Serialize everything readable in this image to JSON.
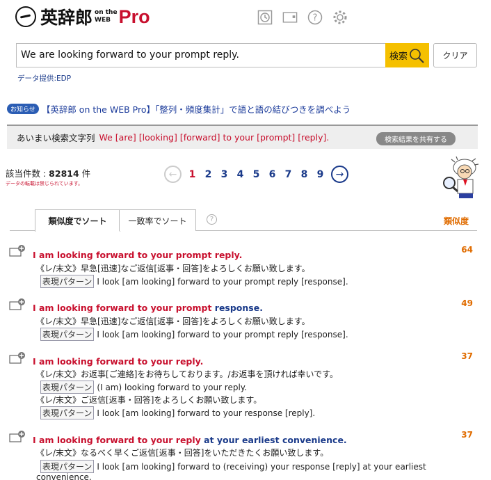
{
  "header": {
    "logo_jp": "英辞郎",
    "logo_on": "on the",
    "logo_web": "WEB",
    "logo_pro": "Pro"
  },
  "search": {
    "value": "We are looking forward to your prompt reply.",
    "button": "検索",
    "clear": "クリア"
  },
  "provider": "データ提供:EDP",
  "notice": {
    "badge": "お知らせ",
    "text": "【英辞郎 on the WEB Pro】「整列・頻度集計」で語と語の結びつきを調べよう"
  },
  "fuzzy": {
    "label": "あいまい検索文字列",
    "query": "We [are] [looking] [forward] to your [prompt] [reply].",
    "share": "検索結果を共有する"
  },
  "count": {
    "label": "該当件数 : ",
    "value": "82814",
    "unit": " 件",
    "note": "データの転載は禁じられています。"
  },
  "pager": {
    "pages": [
      "1",
      "2",
      "3",
      "4",
      "5",
      "6",
      "7",
      "8",
      "9"
    ],
    "current": "1"
  },
  "tabs": {
    "similarity": "類似度でソート",
    "match": "一致率でソート",
    "help": "?",
    "score_label": "類似度"
  },
  "results": [
    {
      "score": "64",
      "head_red": "I am looking forward to your prompt reply.",
      "head_blue": "",
      "lines": [
        {
          "tag": "",
          "text": "《レ/末文》早急[迅速]なご返信[返事・回答]をよろしくお願い致します。"
        },
        {
          "tag": "表現パターン",
          "text": "I look [am looking] forward to your prompt reply [response]."
        }
      ]
    },
    {
      "score": "49",
      "head_red": "I am looking forward to your prompt",
      "head_blue": " response.",
      "lines": [
        {
          "tag": "",
          "text": "《レ/末文》早急[迅速]なご返信[返事・回答]をよろしくお願い致します。"
        },
        {
          "tag": "表現パターン",
          "text": "I look [am looking] forward to your prompt reply [response]."
        }
      ]
    },
    {
      "score": "37",
      "head_red": "I am looking forward to your reply.",
      "head_blue": "",
      "lines": [
        {
          "tag": "",
          "text": "《レ/末文》お返事[ご連絡]をお待ちしております。/お返事を頂ければ幸いです。"
        },
        {
          "tag": "表現パターン",
          "text": "(I am) looking forward to your reply."
        },
        {
          "tag": "",
          "text": "《レ/末文》ご返信[返事・回答]をよろしくお願い致します。"
        },
        {
          "tag": "表現パターン",
          "text": "I look [am looking] forward to your response [reply]."
        }
      ]
    },
    {
      "score": "37",
      "head_red": "I am looking forward to your reply",
      "head_blue": " at your earliest convenience.",
      "lines": [
        {
          "tag": "",
          "text": "《レ/末文》なるべく早くご返信[返事・回答]をいただきたくお願い致します。"
        },
        {
          "tag": "表現パターン",
          "text": "I look [am looking] forward to (receiving) your response [reply] at your earliest"
        },
        {
          "tag": "",
          "text": "convenience."
        }
      ]
    }
  ]
}
